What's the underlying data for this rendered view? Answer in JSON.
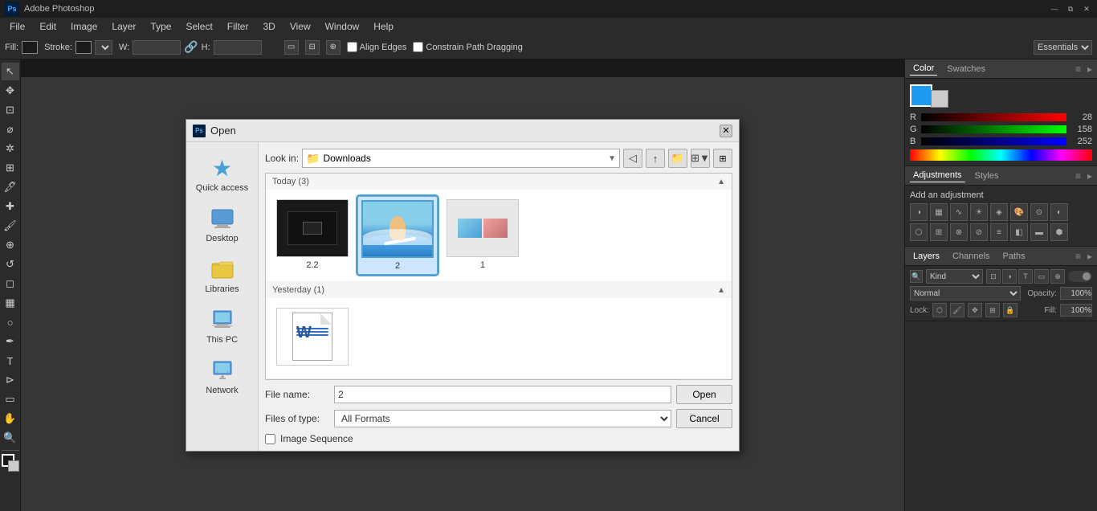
{
  "app": {
    "title": "Adobe Photoshop",
    "logo": "Ps",
    "window_controls": [
      "minimize",
      "restore",
      "close"
    ]
  },
  "menubar": {
    "items": [
      "Ps",
      "File",
      "Edit",
      "Image",
      "Layer",
      "Type",
      "Select",
      "Filter",
      "3D",
      "View",
      "Window",
      "Help"
    ]
  },
  "optionsbar": {
    "fill_label": "Fill:",
    "stroke_label": "Stroke:",
    "w_label": "W:",
    "h_label": "H:",
    "align_edges_label": "Align Edges",
    "constrain_label": "Constrain Path Dragging",
    "essentials_label": "Essentials"
  },
  "rightpanel": {
    "color_tab": "Color",
    "swatches_tab": "Swatches",
    "r_value": "28",
    "g_value": "158",
    "b_value": "252",
    "adjustments_title": "Add an adjustment",
    "adjustments_tab": "Adjustments",
    "styles_tab": "Styles",
    "layers_tab": "Layers",
    "channels_tab": "Channels",
    "paths_tab": "Paths",
    "kind_label": "Kind",
    "blend_mode": "Normal",
    "opacity_label": "Opacity:",
    "opacity_value": "100%",
    "lock_label": "Lock:",
    "fill_label": "Fill:",
    "fill_value": "100%"
  },
  "dialog": {
    "title": "Open",
    "logo": "Ps",
    "lookin_label": "Look in:",
    "lookin_value": "Downloads",
    "sidebar": [
      {
        "id": "quick-access",
        "label": "Quick access",
        "icon": "⭐"
      },
      {
        "id": "desktop",
        "label": "Desktop",
        "icon": "🖥"
      },
      {
        "id": "libraries",
        "label": "Libraries",
        "icon": "📁"
      },
      {
        "id": "this-pc",
        "label": "This PC",
        "icon": "💻"
      },
      {
        "id": "network",
        "label": "Network",
        "icon": "🌐"
      }
    ],
    "groups": [
      {
        "title": "Today (3)",
        "files": [
          {
            "name": "2.2",
            "type": "dark",
            "selected": false
          },
          {
            "name": "2",
            "type": "surf",
            "selected": true
          },
          {
            "name": "1",
            "type": "multi",
            "selected": false
          }
        ]
      },
      {
        "title": "Yesterday (1)",
        "files": [
          {
            "name": "",
            "type": "word",
            "selected": false
          }
        ]
      }
    ],
    "filename_label": "File name:",
    "filename_value": "2",
    "filetype_label": "Files of type:",
    "filetype_value": "All Formats",
    "open_btn": "Open",
    "cancel_btn": "Cancel",
    "image_sequence_label": "Image Sequence"
  }
}
